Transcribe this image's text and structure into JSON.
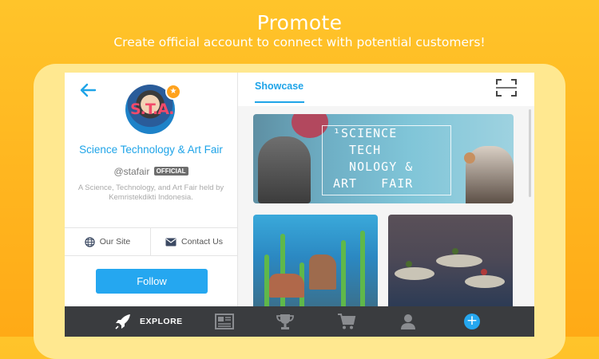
{
  "promo": {
    "title": "Promote",
    "subtitle": "Create official account to connect with potential customers!"
  },
  "profile": {
    "back_icon": "arrow-left-icon",
    "avatar_text": "S.T.A.F",
    "name": "Science Technology & Art Fair",
    "handle": "@stafair",
    "badge": "OFFICIAL",
    "description": "A Science, Technology, and Art Fair held by Kemristekdikti Indonesia.",
    "links": [
      {
        "label": "Our Site",
        "icon": "globe-icon"
      },
      {
        "label": "Contact Us",
        "icon": "envelope-icon"
      }
    ],
    "follow_label": "Follow"
  },
  "showcase": {
    "tab_label": "Showcase",
    "scan_icon": "scan-frame-icon",
    "banner_text": "¹SCIENCE\n  TECH\n  NOLOGY &\nART   FAIR"
  },
  "bottom_nav": {
    "items": [
      {
        "label": "EXPLORE",
        "icon": "rocket-icon",
        "active": true
      },
      {
        "label": "",
        "icon": "newspaper-icon"
      },
      {
        "label": "",
        "icon": "trophy-icon"
      },
      {
        "label": "",
        "icon": "cart-icon"
      },
      {
        "label": "",
        "icon": "user-icon"
      },
      {
        "label": "+",
        "icon": "add-icon"
      }
    ]
  },
  "colors": {
    "accent": "#1fa4e8",
    "follow_button": "#25a7f0",
    "background": "#ffb51f",
    "nav_bar": "#3a3c3f",
    "star_badge": "#ffa21c"
  }
}
